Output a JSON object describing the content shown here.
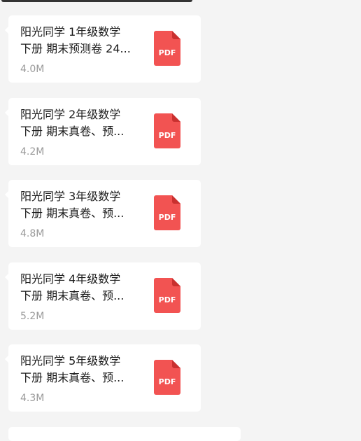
{
  "messages": [
    {
      "file_name": "阳光同学 1年级数学\n下册 期末预测卷 24...",
      "file_size": "4.0M",
      "file_type": "PDF"
    },
    {
      "file_name": "阳光同学 2年级数学\n下册 期末真卷、预...",
      "file_size": "4.2M",
      "file_type": "PDF"
    },
    {
      "file_name": "阳光同学 3年级数学\n下册 期末真卷、预...",
      "file_size": "4.8M",
      "file_type": "PDF"
    },
    {
      "file_name": "阳光同学 4年级数学\n下册 期末真卷、预...",
      "file_size": "5.2M",
      "file_type": "PDF"
    },
    {
      "file_name": "阳光同学 5年级数学\n下册 期末真卷、预...",
      "file_size": "4.3M",
      "file_type": "PDF"
    }
  ],
  "colors": {
    "pdf_icon": "#f25352",
    "pdf_icon_fold": "#c9302f",
    "card_background": "#ffffff",
    "page_background": "#f4f4f4"
  },
  "icons": {
    "file": "pdf-file-icon"
  }
}
